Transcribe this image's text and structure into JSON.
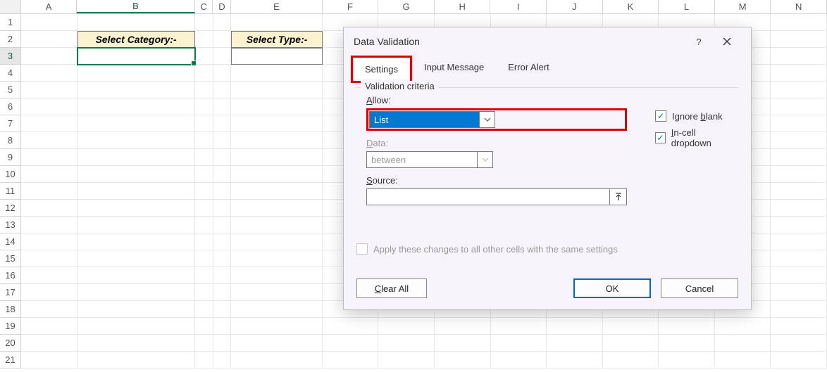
{
  "sheet": {
    "columns": [
      "A",
      "B",
      "C",
      "D",
      "E",
      "F",
      "G",
      "H",
      "I",
      "J",
      "K",
      "L",
      "M",
      "N"
    ],
    "rows": [
      "1",
      "2",
      "3",
      "4",
      "5",
      "6",
      "7",
      "8",
      "9",
      "10",
      "11",
      "12",
      "13",
      "14",
      "15",
      "16",
      "17",
      "18",
      "19",
      "20",
      "21"
    ],
    "selected_col": "B",
    "selected_row": "3",
    "labels": {
      "b2": "Select Category:-",
      "e2": "Select Type:-"
    }
  },
  "dialog": {
    "title": "Data Validation",
    "tabs": {
      "settings": "Settings",
      "input_message": "Input Message",
      "error_alert": "Error Alert"
    },
    "active_tab": "settings",
    "fieldset": "Validation criteria",
    "allow_label": "Allow:",
    "allow_value": "List",
    "data_label": "Data:",
    "data_value": "between",
    "source_label": "Source:",
    "source_value": "",
    "ignore_blank": "Ignore blank",
    "ignore_blank_checked": true,
    "in_cell_dropdown": "In-cell dropdown",
    "in_cell_dropdown_checked": true,
    "apply_changes": "Apply these changes to all other cells with the same settings",
    "apply_changes_checked": false,
    "buttons": {
      "clear_all": "Clear All",
      "ok": "OK",
      "cancel": "Cancel"
    }
  }
}
